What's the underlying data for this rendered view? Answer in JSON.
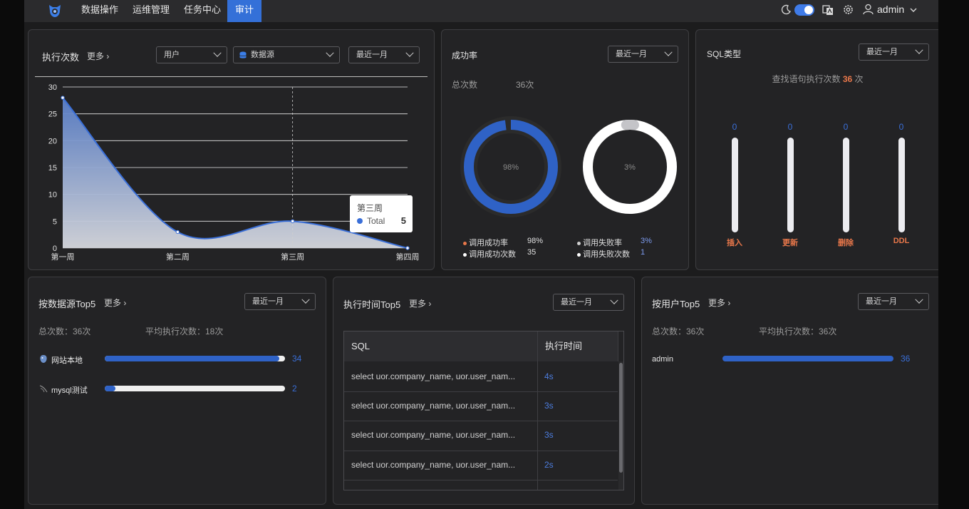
{
  "nav": {
    "items": [
      {
        "label": "数据操作",
        "active": false
      },
      {
        "label": "运维管理",
        "active": false
      },
      {
        "label": "任务中心",
        "active": false
      },
      {
        "label": "审计",
        "active": true
      }
    ],
    "user": "admin",
    "accent": "#3470d8"
  },
  "exec_panel": {
    "title": "执行次数",
    "more": "更多 ›",
    "user_select": "用户",
    "datasource_select": "数据源",
    "range_select": "最近一月",
    "tooltip": {
      "title": "第三周",
      "series": "Total",
      "value": "5"
    },
    "chart_data": {
      "type": "area",
      "categories": [
        "第一周",
        "第二周",
        "第三周",
        "第四周"
      ],
      "series": [
        {
          "name": "Total",
          "values": [
            28,
            3,
            5,
            0
          ]
        }
      ],
      "ylim": [
        0,
        30
      ],
      "yticks": [
        "0",
        "5",
        "10",
        "15",
        "20",
        "25",
        "30"
      ],
      "grid": true,
      "color": "#3a6fd8"
    }
  },
  "success_panel": {
    "title": "成功率",
    "range_select": "最近一月",
    "total_label": "总次数",
    "total_value": "36次",
    "ring_success_label": "98%",
    "ring_fail_label": "3%",
    "success_fraction": 0.98,
    "fail_fraction": 0.03,
    "legend": [
      {
        "label": "调用成功率",
        "value": "98%"
      },
      {
        "label": "调用成功次数",
        "value": "35"
      },
      {
        "label": "调用失败率",
        "value": "3%"
      },
      {
        "label": "调用失败次数",
        "value": "1"
      }
    ]
  },
  "sql_panel": {
    "title": "SQL类型",
    "range_select": "最近一月",
    "summary_prefix": "查找语句执行次数",
    "summary_value": "36",
    "summary_suffix": "次",
    "bars": [
      {
        "label": "插入",
        "value": "0"
      },
      {
        "label": "更新",
        "value": "0"
      },
      {
        "label": "删除",
        "value": "0"
      },
      {
        "label": "DDL",
        "value": "0"
      }
    ]
  },
  "ds_panel": {
    "title": "按数据源Top5",
    "more": "更多 ›",
    "range_select": "最近一月",
    "total": "总次数：36次",
    "avg": "平均执行次数：18次",
    "rows": [
      {
        "name": "网站本地",
        "value": "34",
        "fraction": 0.97
      },
      {
        "name": "mysql测试",
        "value": "2",
        "fraction": 0.06
      }
    ]
  },
  "time_panel": {
    "title": "执行时间Top5",
    "more": "更多 ›",
    "range_select": "最近一月",
    "columns": [
      "SQL",
      "执行时间"
    ],
    "rows": [
      {
        "sql": "select uor.company_name, uor.user_nam...",
        "time": "4s"
      },
      {
        "sql": "select uor.company_name, uor.user_nam...",
        "time": "3s"
      },
      {
        "sql": "select uor.company_name, uor.user_nam...",
        "time": "3s"
      },
      {
        "sql": "select uor.company_name, uor.user_nam...",
        "time": "2s"
      }
    ]
  },
  "user_panel": {
    "title": "按用户Top5",
    "more": "更多 ›",
    "range_select": "最近一月",
    "total": "总次数：36次",
    "avg": "平均执行次数：36次",
    "rows": [
      {
        "name": "admin",
        "value": "36",
        "fraction": 1.0
      }
    ]
  }
}
